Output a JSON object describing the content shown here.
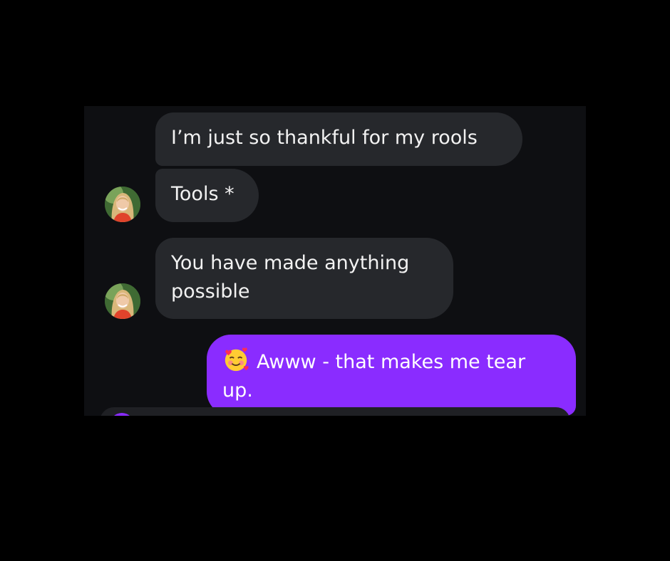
{
  "messages": [
    {
      "id": "m1",
      "direction": "incoming",
      "text": "I’m just so thankful for my rools"
    },
    {
      "id": "m2",
      "direction": "incoming",
      "text": "Tools *"
    },
    {
      "id": "m3",
      "direction": "incoming",
      "line1": "You have made anything",
      "line2": "possible"
    },
    {
      "id": "m4",
      "direction": "outgoing",
      "emoji": "smiling-face-with-hearts-icon",
      "line1": "Awww - that makes me tear",
      "line2": "up."
    }
  ],
  "colors": {
    "background": "#000000",
    "chat_background": "#0e0f12",
    "incoming_bubble": "#26282c",
    "outgoing_bubble": "#8a2cff",
    "text": "#f2f2f2"
  }
}
